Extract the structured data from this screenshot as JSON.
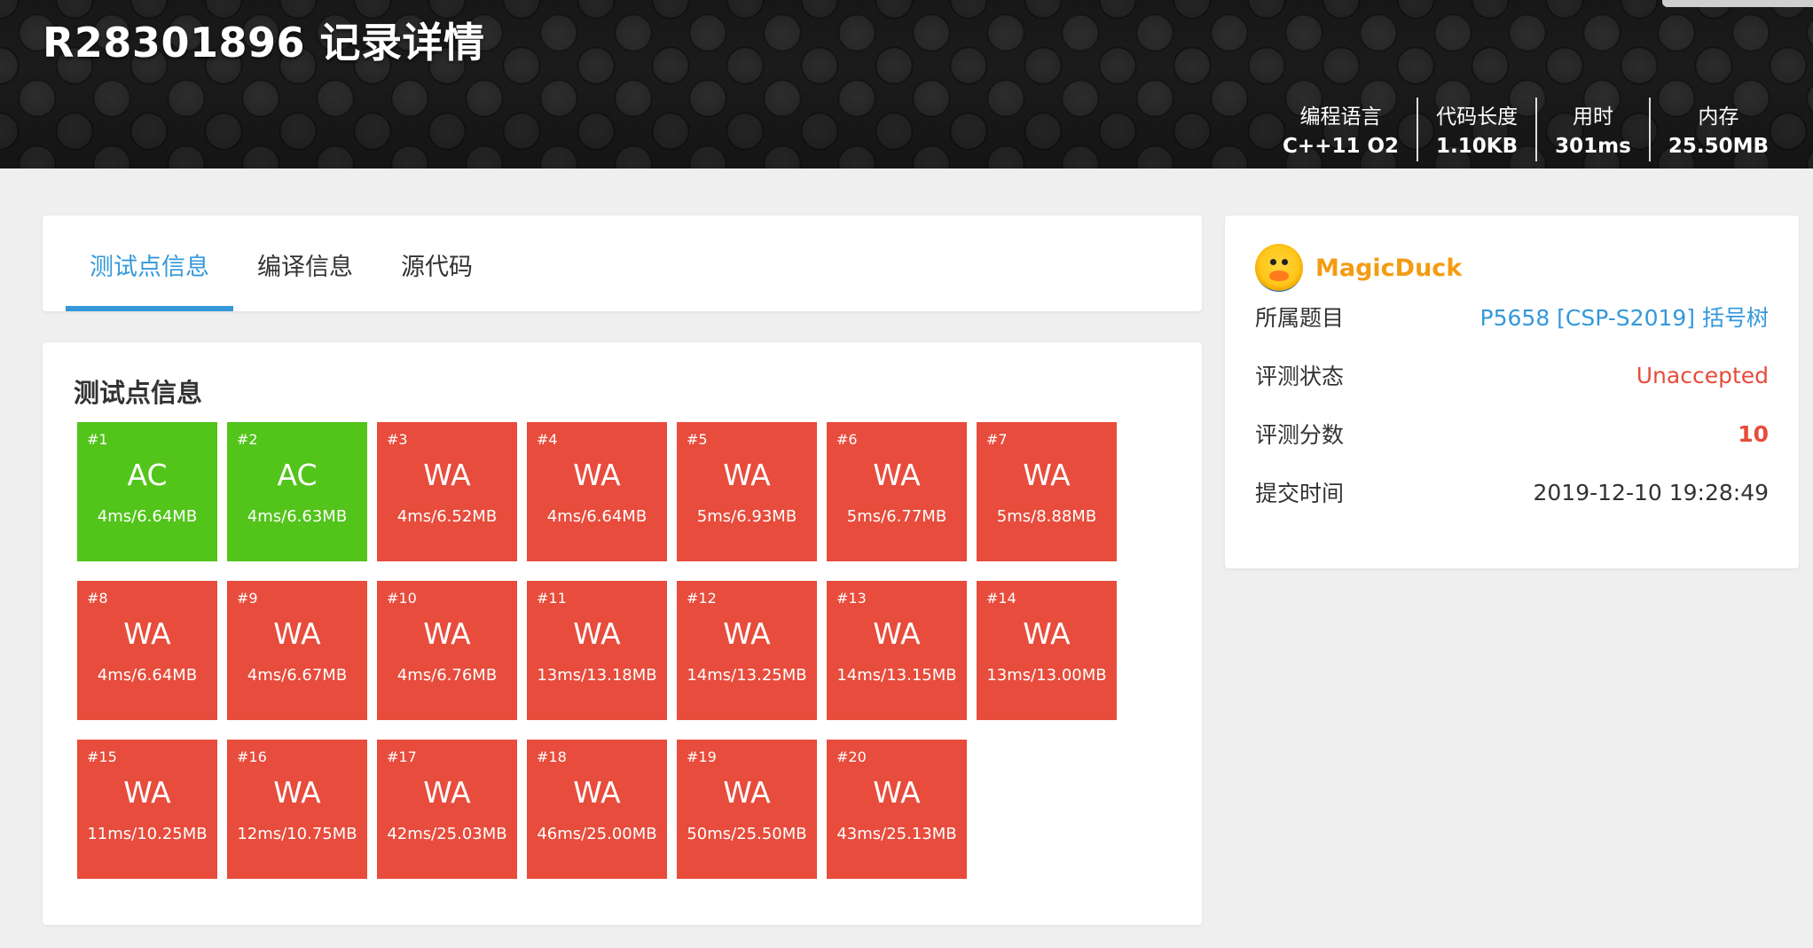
{
  "header": {
    "title": "R28301896 记录详情",
    "stats": [
      {
        "label": "编程语言",
        "value": "C++11 O2"
      },
      {
        "label": "代码长度",
        "value": "1.10KB"
      },
      {
        "label": "用时",
        "value": "301ms"
      },
      {
        "label": "内存",
        "value": "25.50MB"
      }
    ]
  },
  "tabs": [
    {
      "label": "测试点信息",
      "active": true
    },
    {
      "label": "编译信息",
      "active": false
    },
    {
      "label": "源代码",
      "active": false
    }
  ],
  "cases_section": {
    "title": "测试点信息",
    "cases": [
      {
        "num": "#1",
        "status": "AC",
        "info": "4ms/6.64MB"
      },
      {
        "num": "#2",
        "status": "AC",
        "info": "4ms/6.63MB"
      },
      {
        "num": "#3",
        "status": "WA",
        "info": "4ms/6.52MB"
      },
      {
        "num": "#4",
        "status": "WA",
        "info": "4ms/6.64MB"
      },
      {
        "num": "#5",
        "status": "WA",
        "info": "5ms/6.93MB"
      },
      {
        "num": "#6",
        "status": "WA",
        "info": "5ms/6.77MB"
      },
      {
        "num": "#7",
        "status": "WA",
        "info": "5ms/8.88MB"
      },
      {
        "num": "#8",
        "status": "WA",
        "info": "4ms/6.64MB"
      },
      {
        "num": "#9",
        "status": "WA",
        "info": "4ms/6.67MB"
      },
      {
        "num": "#10",
        "status": "WA",
        "info": "4ms/6.76MB"
      },
      {
        "num": "#11",
        "status": "WA",
        "info": "13ms/13.18MB"
      },
      {
        "num": "#12",
        "status": "WA",
        "info": "14ms/13.25MB"
      },
      {
        "num": "#13",
        "status": "WA",
        "info": "14ms/13.15MB"
      },
      {
        "num": "#14",
        "status": "WA",
        "info": "13ms/13.00MB"
      },
      {
        "num": "#15",
        "status": "WA",
        "info": "11ms/10.25MB"
      },
      {
        "num": "#16",
        "status": "WA",
        "info": "12ms/10.75MB"
      },
      {
        "num": "#17",
        "status": "WA",
        "info": "42ms/25.03MB"
      },
      {
        "num": "#18",
        "status": "WA",
        "info": "46ms/25.00MB"
      },
      {
        "num": "#19",
        "status": "WA",
        "info": "50ms/25.50MB"
      },
      {
        "num": "#20",
        "status": "WA",
        "info": "43ms/25.13MB"
      }
    ]
  },
  "sidebar": {
    "username": "MagicDuck",
    "avatar_icon": "duck-avatar-icon",
    "rows": [
      {
        "key": "所属题目",
        "value": "P5658 [CSP-S2019] 括号树",
        "kind": "link"
      },
      {
        "key": "评测状态",
        "value": "Unaccepted",
        "kind": "bad"
      },
      {
        "key": "评测分数",
        "value": "10",
        "kind": "score"
      },
      {
        "key": "提交时间",
        "value": "2019-12-10 19:28:49",
        "kind": "plain"
      }
    ]
  },
  "colors": {
    "accent": "#3498db",
    "ac": "#52c41a",
    "wa": "#e74c3c",
    "username": "#f39c12"
  }
}
